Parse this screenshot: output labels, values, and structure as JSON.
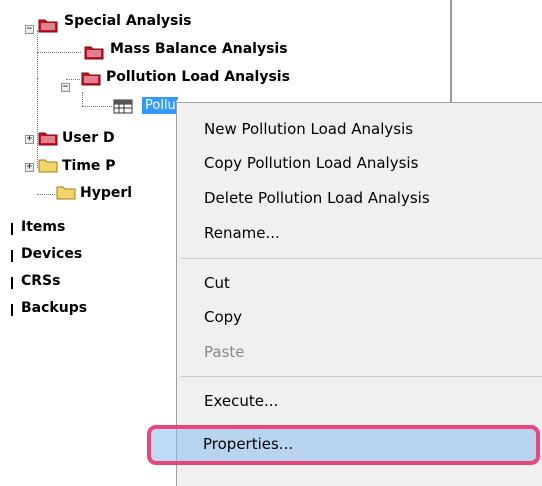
{
  "tree": {
    "special_analysis": "Special Analysis",
    "mass_balance": "Mass Balance Analysis",
    "pollution_load": "Pollution Load Analysis",
    "pollution_load_item": "Pollution Load",
    "user_d": "User D",
    "time_p": "Time P",
    "hyperl": "Hyperl",
    "items": "Items",
    "devices": "Devices",
    "crss": "CRSs",
    "backups": "Backups",
    "expand_symbol": "+",
    "collapse_symbol": "−"
  },
  "context_menu": {
    "new": "New Pollution Load Analysis",
    "copy_analysis": "Copy Pollution Load Analysis",
    "delete": "Delete Pollution Load Analysis",
    "rename": "Rename...",
    "cut": "Cut",
    "copy": "Copy",
    "paste": "Paste",
    "execute": "Execute...",
    "properties": "Properties..."
  },
  "colors": {
    "selection": "#3399ff",
    "menu_background": "#f0f0f0",
    "highlight": "#cce4f7",
    "callout_border": "#e8467c",
    "special_folder_red": "#c8102e",
    "folder_yellow": "#f3d46b"
  },
  "icons": {
    "special_folder": "red-folder-icon",
    "normal_folder": "yellow-folder-icon",
    "table": "table-icon"
  }
}
